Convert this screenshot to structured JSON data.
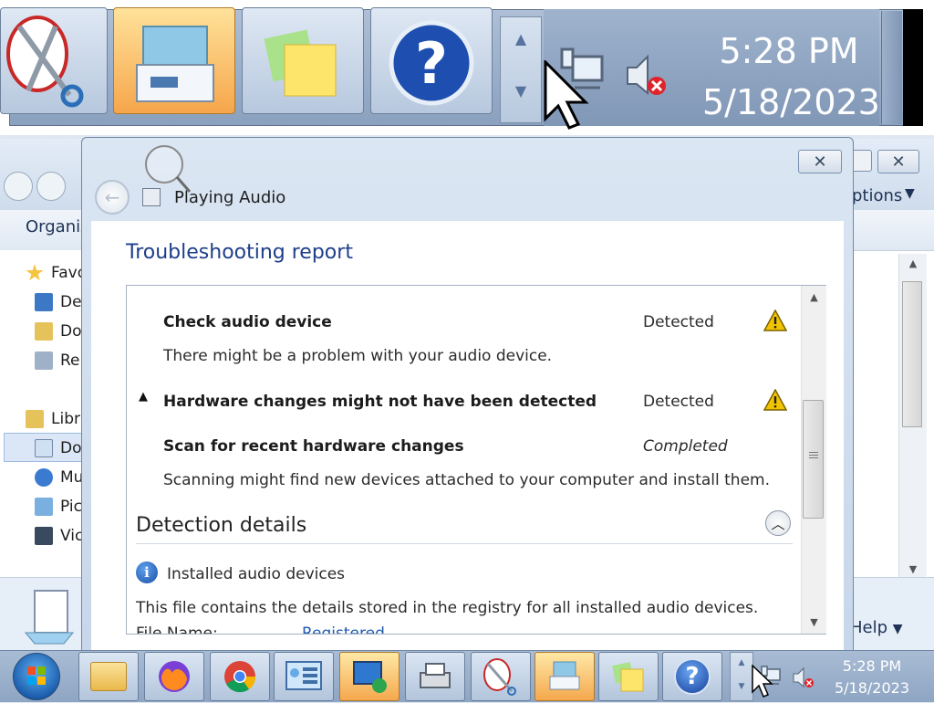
{
  "magnifier": {
    "clock_time": "5:28 PM",
    "clock_date": "5/18/2023",
    "buttons": [
      "snipping-tool",
      "windows-explorer",
      "sticky-notes",
      "help-and-support"
    ]
  },
  "explorer": {
    "organize_label": "Organiz",
    "options_label": "ptions",
    "help_label": "Help",
    "nav": [
      {
        "label": "Favo"
      },
      {
        "label": "De"
      },
      {
        "label": "Do"
      },
      {
        "label": "Re"
      },
      {
        "label": "Libra"
      },
      {
        "label": "Do"
      },
      {
        "label": "Mu"
      },
      {
        "label": "Pic"
      },
      {
        "label": "Vic"
      }
    ]
  },
  "dialog": {
    "title": "Playing Audio",
    "heading": "Troubleshooting report",
    "rows": [
      {
        "title": "Check audio device",
        "status": "Detected",
        "desc": "There might be a problem with your audio device."
      },
      {
        "title": "Hardware changes might not have been detected",
        "status": "Detected"
      },
      {
        "title": "Scan for recent hardware changes",
        "status": "Completed",
        "desc": "Scanning might find new devices attached to your computer and install them."
      }
    ],
    "section_heading": "Detection details",
    "installed_label": "Installed audio devices",
    "installed_desc": "This file contains the details stored in the registry for all installed audio devices.",
    "file_name_partial": "File Name:",
    "file_value_partial": "Registered"
  },
  "taskbar": {
    "clock_time": "5:28 PM",
    "clock_date": "5/18/2023",
    "buttons": [
      "windows-explorer",
      "firefox",
      "chrome",
      "control-panel",
      "remote-desktop",
      "fax-and-scan",
      "snipping-tool",
      "windows-explorer-2",
      "sticky-notes",
      "help-and-support"
    ]
  },
  "colors": {
    "accent_heading": "#1e3e8a",
    "taskbar": "#9fb3cd",
    "warning": "#f2c400"
  }
}
